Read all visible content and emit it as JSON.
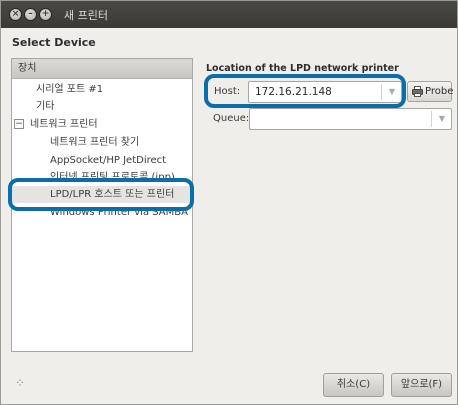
{
  "window": {
    "title": "새 프린터",
    "close_symbol": "×",
    "minimize_symbol": "–",
    "maximize_symbol": "+"
  },
  "heading": "Select Device",
  "device_list": {
    "header": "장치",
    "items": [
      {
        "label": "시리얼 포트 #1"
      },
      {
        "label": "기타"
      },
      {
        "label": "네트워크 프린터",
        "expander": "−"
      },
      {
        "label": "네트워크 프린터 찾기"
      },
      {
        "label": "AppSocket/HP JetDirect"
      },
      {
        "label": "인터넷 프린팅 프로토콜 (ipp)"
      },
      {
        "label": "LPD/LPR 호스트 또는 프린터"
      },
      {
        "label": "Windows Printer via SAMBA"
      }
    ],
    "selected": "LPD/LPR 호스트 또는 프린터"
  },
  "lpd": {
    "section_label": "Location of the LPD network printer",
    "host_label": "Host:",
    "host_value": "172.16.21.148",
    "queue_label": "Queue:",
    "queue_value": "",
    "probe_label": "Probe",
    "dropdown_symbol": "▼"
  },
  "buttons": {
    "cancel": "취소(C)",
    "forward": "앞으로(F)"
  },
  "spinner_symbol": "⁘",
  "colors": {
    "highlight": "#0b6ea8",
    "titlebar": "#3f3e3a",
    "selected_row": "#e6e4e0"
  }
}
